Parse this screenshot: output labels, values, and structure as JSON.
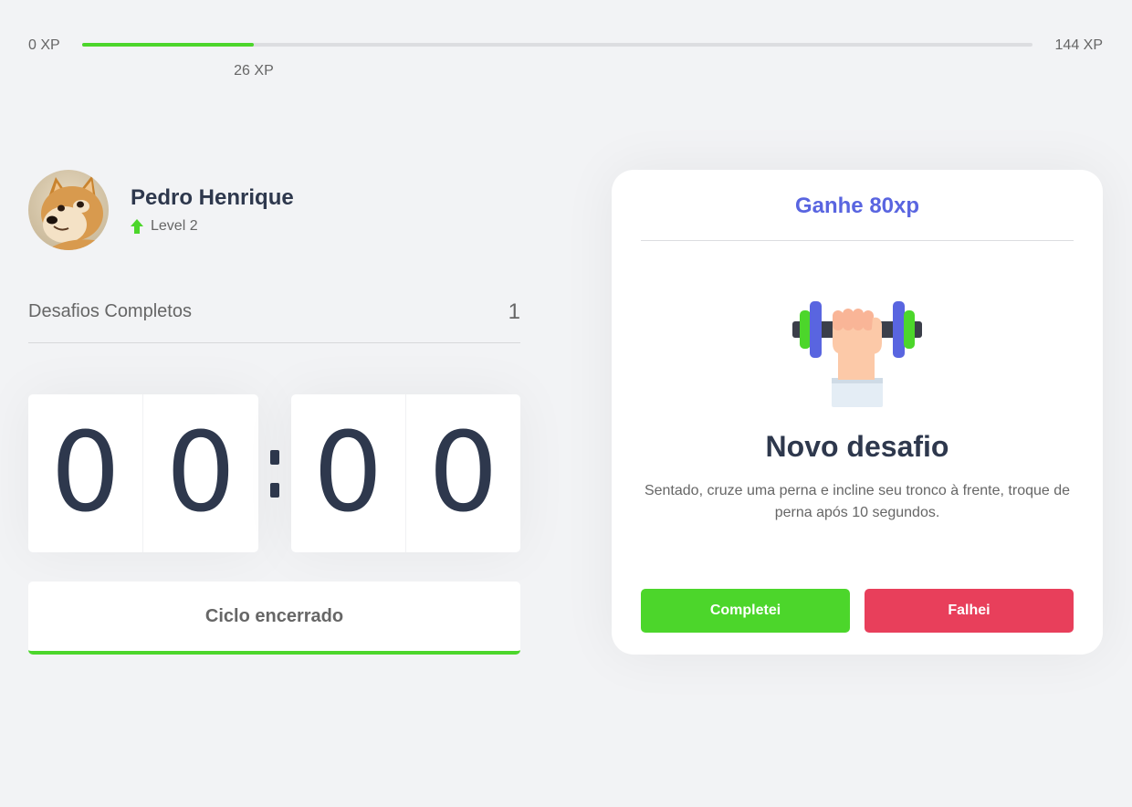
{
  "xp": {
    "min_label": "0 XP",
    "max_label": "144 XP",
    "current_label": "26 XP",
    "current": 26,
    "max": 144,
    "bar_color": "#4cd62b"
  },
  "profile": {
    "name": "Pedro Henrique",
    "level_label": "Level 2",
    "level_icon": "arrow-up-icon",
    "avatar": "shiba-inu-dog-photo"
  },
  "completed": {
    "label": "Desafios Completos",
    "count": "1"
  },
  "countdown": {
    "minute_left": "0",
    "minute_right": "0",
    "second_left": "0",
    "second_right": "0"
  },
  "cycle_button": {
    "label": "Ciclo encerrado"
  },
  "challenge": {
    "header": "Ganhe 80xp",
    "icon": "dumbbell-hand-icon",
    "title": "Novo desafio",
    "description": "Sentado, cruze uma perna e incline seu tronco à frente, troque de perna após 10 segundos.",
    "success_label": "Completei",
    "fail_label": "Falhei"
  },
  "colors": {
    "background": "#f2f3f5",
    "green": "#4cd62b",
    "red": "#e83f5b",
    "blue": "#5965e0",
    "title": "#2e384d",
    "text": "#666666"
  }
}
